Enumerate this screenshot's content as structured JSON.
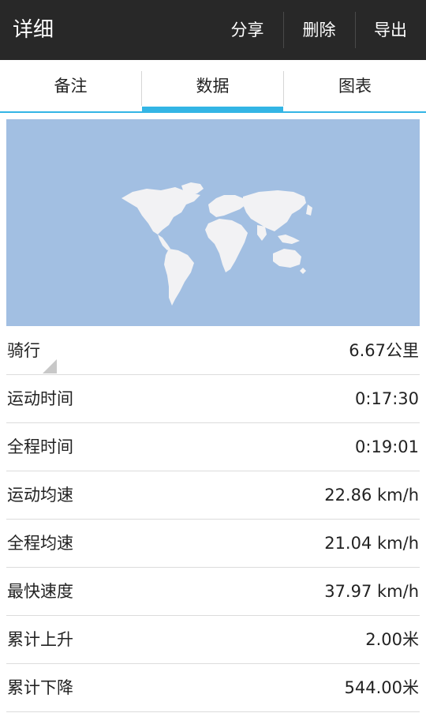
{
  "actionbar": {
    "title": "详细",
    "actions": {
      "share": "分享",
      "delete": "删除",
      "export": "导出"
    }
  },
  "tabs": {
    "notes": "备注",
    "data": "数据",
    "chart": "图表",
    "selected": "数据"
  },
  "colors": {
    "actionbar": "#282828",
    "accent": "#33b5e5",
    "map_water": "#a2bfe2",
    "map_land": "#f2f2f4"
  },
  "stats": [
    {
      "label": "骑行",
      "value": "6.67公里"
    },
    {
      "label": "运动时间",
      "value": "0:17:30"
    },
    {
      "label": "全程时间",
      "value": "0:19:01"
    },
    {
      "label": "运动均速",
      "value": "22.86 km/h"
    },
    {
      "label": "全程均速",
      "value": "21.04 km/h"
    },
    {
      "label": "最快速度",
      "value": "37.97 km/h"
    },
    {
      "label": "累计上升",
      "value": "2.00米"
    },
    {
      "label": "累计下降",
      "value": "544.00米"
    }
  ]
}
